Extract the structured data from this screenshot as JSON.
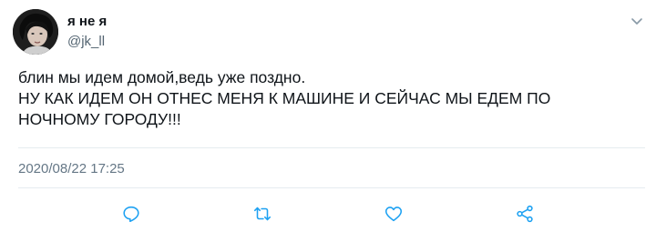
{
  "tweet": {
    "author": {
      "display_name": "я не я",
      "handle": "@jk_ll",
      "avatar": "profile-photo"
    },
    "menu_icon": "chevron-down-icon",
    "text_lines": [
      "блин мы идем домой,ведь уже поздно.",
      "НУ КАК ИДЕМ ОН ОТНЕС МЕНЯ К МАШИНЕ И СЕЙЧАС МЫ ЕДЕМ ПО",
      "НОЧНОМУ ГОРОДУ!!!"
    ],
    "timestamp": "2020/08/22 17:25",
    "actions": [
      {
        "icon": "reply-icon"
      },
      {
        "icon": "retweet-icon"
      },
      {
        "icon": "like-icon"
      },
      {
        "icon": "share-icon"
      }
    ]
  },
  "colors": {
    "icon": "#1da1f2",
    "secondary_text": "#657786",
    "divider": "#e6ecf0"
  }
}
